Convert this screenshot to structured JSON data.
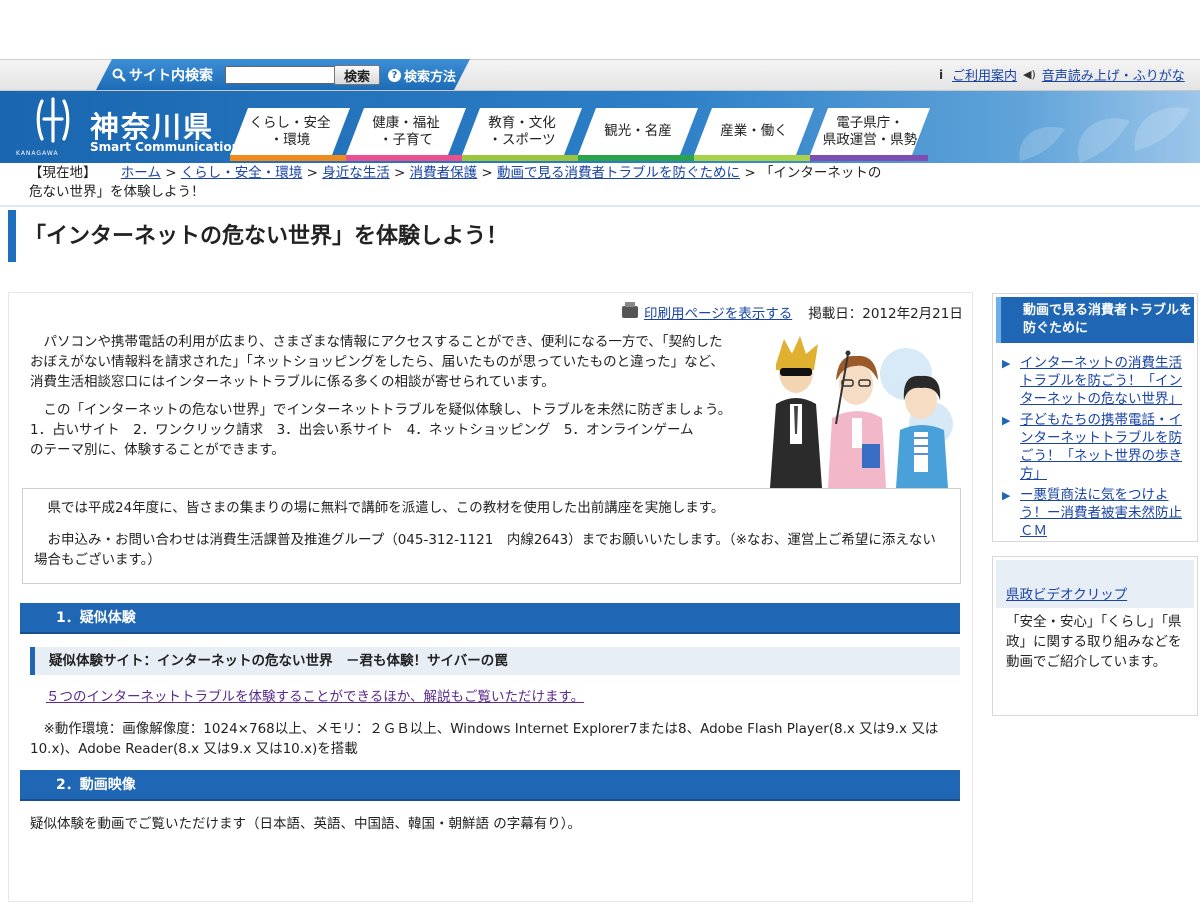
{
  "utility": {
    "search_label": "サイト内検索",
    "search_input_value": "",
    "search_button": "検索",
    "search_help": "検索方法",
    "guide": "ご利用案内",
    "voice": "音声読み上げ・ふりがな"
  },
  "header": {
    "logo_name": "神奈川県",
    "logo_sub": "Smart Communication",
    "logo_kanagawa": "KANAGAWA",
    "nav": [
      {
        "line1": "くらし・安全",
        "line2": "・環境",
        "color": "#f08a1c"
      },
      {
        "line1": "健康・福祉",
        "line2": "・子育て",
        "color": "#e8508f"
      },
      {
        "line1": "教育・文化",
        "line2": "・スポーツ",
        "color": "#9bc53d"
      },
      {
        "line1": "観光・名産",
        "line2": "",
        "color": "#2aa34a"
      },
      {
        "line1": "産業・働く",
        "line2": "",
        "color": "#a9d24b"
      },
      {
        "line1": "電子県庁・",
        "line2": "県政運営・県勢",
        "color": "#7e4fb3"
      }
    ]
  },
  "breadcrumb": {
    "label": "【現在地】",
    "items": [
      "ホーム",
      "くらし・安全・環境",
      "身近な生活",
      "消費者保護",
      "動画で見る消費者トラブルを防ぐために"
    ],
    "current_line1": "「インターネットの",
    "current_line2": "危ない世界」を体験しよう！"
  },
  "page_title": "「インターネットの危ない世界」を体験しよう！",
  "print": {
    "link": "印刷用ページを表示する",
    "date": "掲載日：2012年2月21日"
  },
  "intro": {
    "p1_lines": [
      "　パソコンや携帯電話の利用が広まり、さまざまな情報にアクセスすることができ、便利になる一方で、「契約した",
      "おぼえがない情報料を請求された」「ネットショッピングをしたら、届いたものが思っていたものと違った」など、",
      "消費生活相談窓口にはインターネットトラブルに係る多くの相談が寄せられています。"
    ],
    "p2_lines": [
      "　この「インターネットの危ない世界」でインターネットトラブルを疑似体験し、トラブルを未然に防ぎましょう。",
      "1．占いサイト　2．ワンクリック請求　3．出会い系サイト　4．ネットショッピング　5．オンラインゲーム",
      "のテーマ別に、体験することができます。"
    ]
  },
  "notice": {
    "p1": "　県では平成24年度に、皆さまの集まりの場に無料で講師を派遣し、この教材を使用した出前講座を実施します。",
    "p2_line1": "　お申込み・お問い合わせは消費生活課普及推進グループ（045-312-1121　内線2643）までお願いいたします。（※なお、運営上ご希望に添えない",
    "p2_line2": "場合もございます。）"
  },
  "section1": {
    "heading": "1．疑似体験",
    "subheading": "疑似体験サイト：インターネットの危ない世界　－君も体験！サイバーの罠",
    "link": "５つのインターネットトラブルを体験することができるほか、解説もご覧いただけます。",
    "env_line1": "　※動作環境：画像解像度：1024×768以上、メモリ：２ＧＢ以上、Windows Internet Explorer7または8、Adobe Flash Player(8.x 又は9.x 又は",
    "env_line2": "10.x)、Adobe Reader(8.x 又は9.x 又は10.x)を搭載"
  },
  "section2": {
    "heading": "2．動画映像",
    "text": "疑似体験を動画でご覧いただけます（日本語、英語、中国語、韓国・朝鮮語 の字幕有り）。"
  },
  "sidebar": {
    "box1_title": "動画で見る消費者トラブルを防ぐために",
    "links": [
      "インターネットの消費生活トラブルを防ごう！「インターネットの危ない世界」",
      "子どもたちの携帯電話・インターネットトラブルを防ごう！「ネット世界の歩き方」",
      "ー悪質商法に気をつけよう！ー消費者被害未然防止ＣＭ"
    ],
    "box2_title": "県政ビデオクリップ",
    "box2_text": "「安全・安心」「くらし」「県政」に関する取り組みなどを動画でご紹介しています。"
  }
}
